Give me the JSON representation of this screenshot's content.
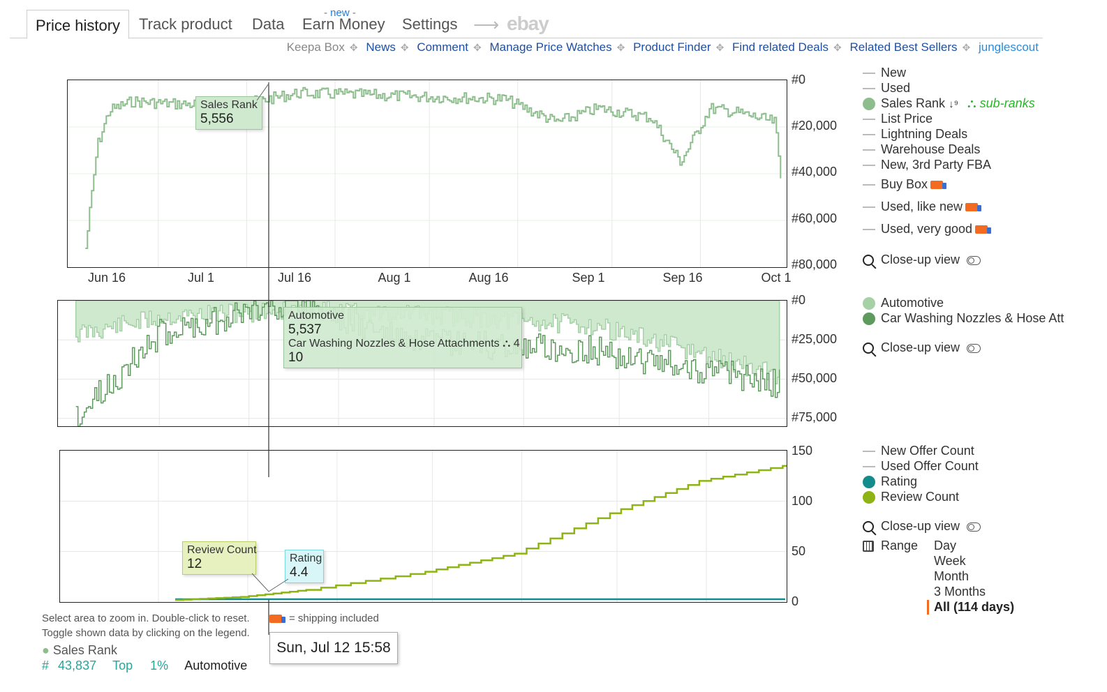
{
  "tabs": {
    "items": [
      "Price history",
      "Track product",
      "Data",
      "Earn Money",
      "Settings"
    ],
    "new_tag": "new",
    "ebay_label": "ebay"
  },
  "links": {
    "keepa_box": "Keepa Box",
    "news": "News",
    "comment": "Comment",
    "manage": "Manage Price Watches",
    "finder": "Product Finder",
    "deals": "Find related Deals",
    "sellers": "Related Best Sellers",
    "junglescout": "junglescout"
  },
  "colors": {
    "sales_rank": "#8dbd8d",
    "automotive": "#a6d1a6",
    "subcat": "#5e9a5e",
    "rating": "#118b8b",
    "review": "#8db414",
    "link_blue": "#1f4fa2"
  },
  "chart_data": [
    {
      "type": "line",
      "title": "",
      "series": [
        {
          "name": "Sales Rank",
          "x": [
            "2020-06-06",
            "2020-06-08",
            "2020-06-10",
            "2020-06-14",
            "2020-06-20",
            "2020-07-01",
            "2020-07-12",
            "2020-07-20",
            "2020-08-01",
            "2020-08-16",
            "2020-08-25",
            "2020-09-01",
            "2020-09-10",
            "2020-09-15",
            "2020-09-20",
            "2020-09-25",
            "2020-10-01",
            "2020-10-02"
          ],
          "values": [
            72000,
            28000,
            13000,
            9000,
            10000,
            11000,
            5556,
            6000,
            7000,
            8000,
            18000,
            12000,
            16000,
            35000,
            12000,
            14000,
            18000,
            43000
          ]
        }
      ],
      "y_ticks": [
        "#0",
        "#20,000",
        "#40,000",
        "#60,000",
        "#80,000"
      ],
      "ylim": [
        0,
        80000
      ],
      "y_inverted": true,
      "x_ticks": [
        "Jun 16",
        "Jul 1",
        "Jul 16",
        "Aug 1",
        "Aug 16",
        "Sep 1",
        "Sep 16",
        "Oct 1"
      ]
    },
    {
      "type": "area",
      "series": [
        {
          "name": "Automotive",
          "x": [
            "2020-06-06",
            "2020-06-20",
            "2020-07-12",
            "2020-08-01",
            "2020-09-01",
            "2020-10-02"
          ],
          "values": [
            20000,
            10000,
            5537,
            8000,
            15000,
            45000
          ]
        },
        {
          "name": "Car Washing Nozzles & Hose Att",
          "x": [
            "2020-06-06",
            "2020-06-20",
            "2020-07-12",
            "2020-08-01",
            "2020-09-01",
            "2020-10-02"
          ],
          "values": [
            70000,
            20000,
            10,
            25000,
            30000,
            50000
          ]
        }
      ],
      "y_ticks": [
        "#0",
        "#25,000",
        "#50,000",
        "#75,000"
      ],
      "ylim": [
        0,
        75000
      ],
      "y_inverted": true
    },
    {
      "type": "line",
      "series": [
        {
          "name": "Rating",
          "x": [
            "2020-06-20",
            "2020-10-02"
          ],
          "values": [
            4.4,
            4.4
          ]
        },
        {
          "name": "Review Count",
          "x": [
            "2020-06-20",
            "2020-07-01",
            "2020-07-12",
            "2020-08-01",
            "2020-08-16",
            "2020-09-01",
            "2020-09-16",
            "2020-10-02"
          ],
          "values": [
            2,
            5,
            12,
            30,
            48,
            88,
            120,
            137
          ]
        }
      ],
      "y_ticks": [
        "150",
        "100",
        "50",
        "0"
      ],
      "ylim": [
        0,
        150
      ]
    }
  ],
  "tooltips": {
    "sales_rank": {
      "label": "Sales Rank",
      "value": "5,556"
    },
    "automotive": {
      "label": "Automotive",
      "value": "5,537",
      "sub_label": "Car Washing Nozzles & Hose Attachments",
      "sub_count": "4",
      "sub_value": "10"
    },
    "review": {
      "label": "Review Count",
      "value": "12"
    },
    "rating": {
      "label": "Rating",
      "value": "4.4"
    }
  },
  "legend1": {
    "items": [
      "New",
      "Used",
      "Sales Rank",
      "List Price",
      "Lightning Deals",
      "Warehouse Deals",
      "New, 3rd Party FBA",
      "Buy Box",
      "Used, like new",
      "Used, very good"
    ],
    "sub_ranks": "sub-ranks",
    "closeup": "Close-up view"
  },
  "legend2": {
    "items": [
      "Automotive",
      "Car Washing Nozzles & Hose Att"
    ],
    "closeup": "Close-up view"
  },
  "legend3": {
    "items": [
      "New Offer Count",
      "Used Offer Count",
      "Rating",
      "Review Count"
    ],
    "closeup": "Close-up view",
    "range_label": "Range",
    "ranges": [
      "Day",
      "Week",
      "Month",
      "3 Months",
      "All (114 days)"
    ]
  },
  "info": {
    "line1": "Select area to zoom in. Double-click to reset.",
    "line2": "Toggle shown data by clicking on the legend.",
    "shipping": "= shipping included",
    "sales_rank": "Sales Rank",
    "hash": "#",
    "rank": "43,837",
    "top": "Top",
    "pct": "1%",
    "category": "Automotive"
  },
  "cursor_time": "Sun, Jul 12 15:58"
}
